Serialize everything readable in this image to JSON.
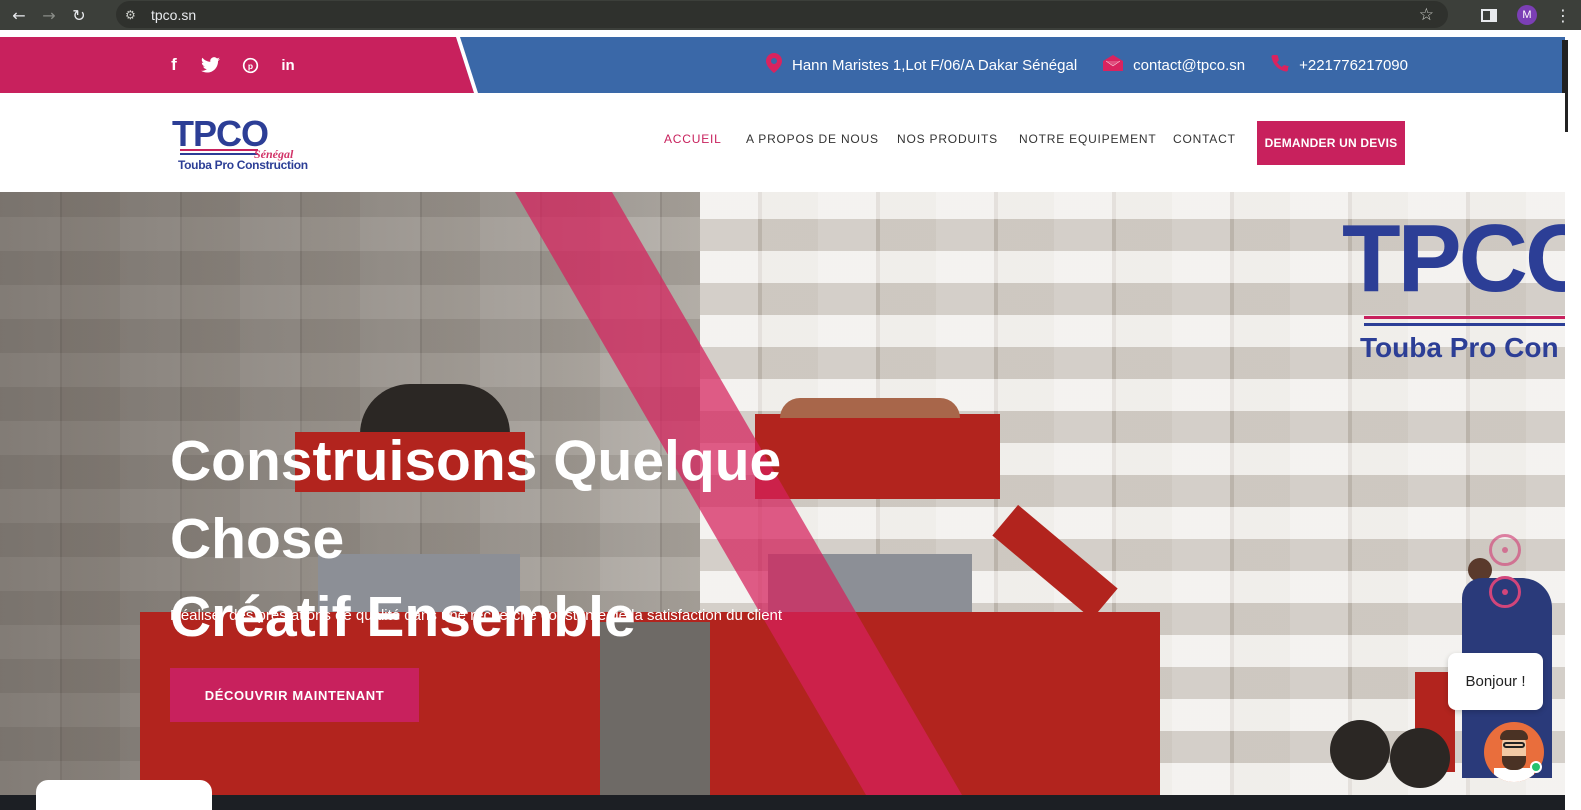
{
  "browser": {
    "url": "tpco.sn",
    "profile_initial": "M"
  },
  "topbar": {
    "address": "Hann Maristes 1,Lot F/06/A Dakar Sénégal",
    "email": "contact@tpco.sn",
    "phone": "+221776217090",
    "social": [
      "facebook-icon",
      "twitter-icon",
      "pinterest-icon",
      "linkedin-icon"
    ],
    "colors": {
      "pink": "#c8215d",
      "blue": "#3a68a8"
    }
  },
  "logo": {
    "main": "TPCO",
    "country": "Sénégal",
    "subtitle": "Touba Pro Construction"
  },
  "nav": {
    "items": [
      {
        "label": "ACCUEIL",
        "active": true
      },
      {
        "label": "A PROPOS DE NOUS",
        "active": false
      },
      {
        "label": "NOS PRODUITS",
        "active": false
      },
      {
        "label": "NOTRE EQUIPEMENT",
        "active": false
      },
      {
        "label": "CONTACT",
        "active": false
      }
    ],
    "cta": "DEMANDER UN DEVIS"
  },
  "hero": {
    "title_line1": "Construisons Quelque Chose",
    "title_line2": "Créatif Ensemble",
    "subtitle": "Réaliser des prestations de qualité dans une recherche constante de la satisfaction du client",
    "button": "DÉCOUVRIR MAINTENANT",
    "logo_main": "TPCO",
    "logo_sub": "Touba Pro Con"
  },
  "chat": {
    "greeting": "Bonjour !"
  }
}
